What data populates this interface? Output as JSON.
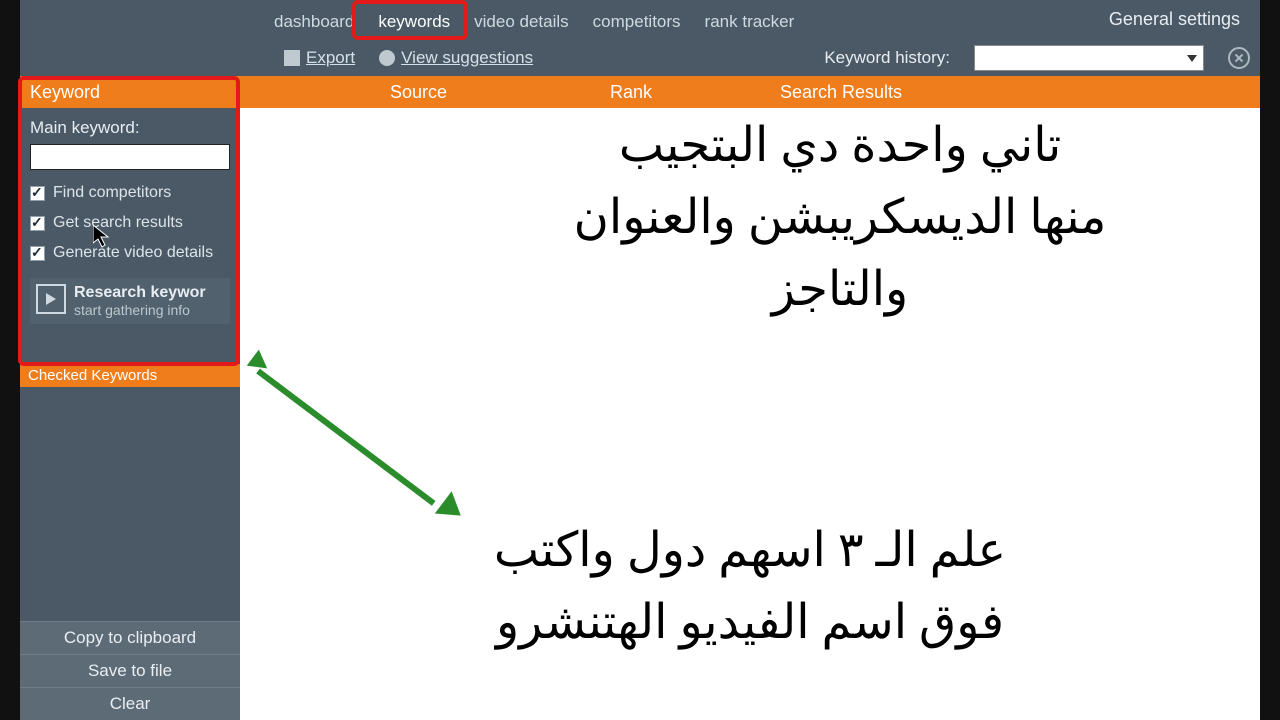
{
  "nav": {
    "tabs": [
      {
        "label": "dashboard"
      },
      {
        "label": "keywords"
      },
      {
        "label": "video details"
      },
      {
        "label": "competitors"
      },
      {
        "label": "rank tracker"
      }
    ],
    "general_settings": "General settings"
  },
  "toolbar": {
    "export": "Export",
    "view_suggestions": "View suggestions",
    "keyword_history_label": "Keyword history:",
    "keyword_history_value": ""
  },
  "table": {
    "cols": {
      "keyword": "Keyword",
      "source": "Source",
      "rank": "Rank",
      "search_results": "Search Results"
    }
  },
  "sidebar": {
    "main_keyword_label": "Main keyword:",
    "main_keyword_value": "",
    "checks": [
      {
        "label": "Find competitors",
        "checked": true
      },
      {
        "label": "Get search results",
        "checked": true
      },
      {
        "label": "Generate video details",
        "checked": true
      }
    ],
    "research_title": "Research keywor",
    "research_sub": "start gathering info",
    "checked_keywords_header": "Checked Keywords",
    "buttons": {
      "copy": "Copy to clipboard",
      "save": "Save to file",
      "clear": "Clear"
    }
  },
  "annotations": {
    "top": "تاني واحدة دي البتجيب\nمنها الديسكريبشن والعنوان\nوالتاجز",
    "bottom": "علم الـ ٣ اسهم دول واكتب\nفوق اسم الفيديو الهتنشرو"
  },
  "highlight_color": "#e21a1a",
  "arrow_color": "#2a8c2a"
}
